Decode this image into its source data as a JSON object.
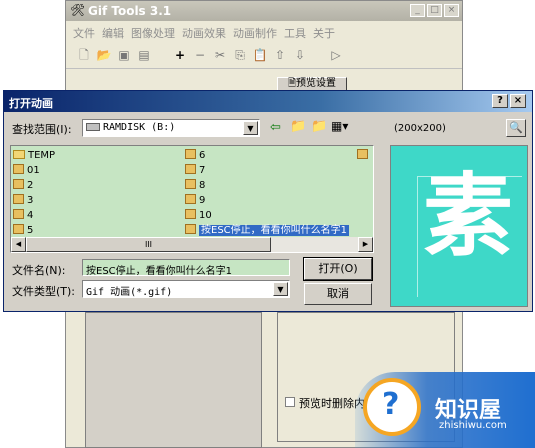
{
  "bg_window": {
    "title": "Gif Tools 3.1",
    "menu": [
      "文件",
      "编辑",
      "图像处理",
      "动画效果",
      "动画制作",
      "工具",
      "关于"
    ],
    "preview_settings_label": "预览设置",
    "delete_on_preview_label": "预览时删除内"
  },
  "dialog": {
    "title": "打开动画",
    "lookin_label": "查找范围(I):",
    "lookin_value": "RAMDISK (B:)",
    "size_label": "(200x200)",
    "files": [
      "TEMP",
      "01",
      "2",
      "3",
      "4",
      "5",
      "6",
      "7",
      "8",
      "9",
      "10",
      "按ESC停止，看看你叫什么名字1"
    ],
    "filename_label": "文件名(N):",
    "filename_value": "按ESC停止，看看你叫什么名字1",
    "filetype_label": "文件类型(T):",
    "filetype_value": "Gif 动画(*.gif)",
    "open_button": "打开(O)",
    "cancel_button": "取消",
    "preview_char": "素",
    "scroll_thumb": "III"
  },
  "watermark": {
    "brand": "知识屋",
    "url": "zhishiwu.com"
  },
  "colors": {
    "preview_bg": "#3ed8c8",
    "list_bg": "#c6e5c3",
    "title_bar": "#0a246a",
    "selection": "#316ac5"
  }
}
